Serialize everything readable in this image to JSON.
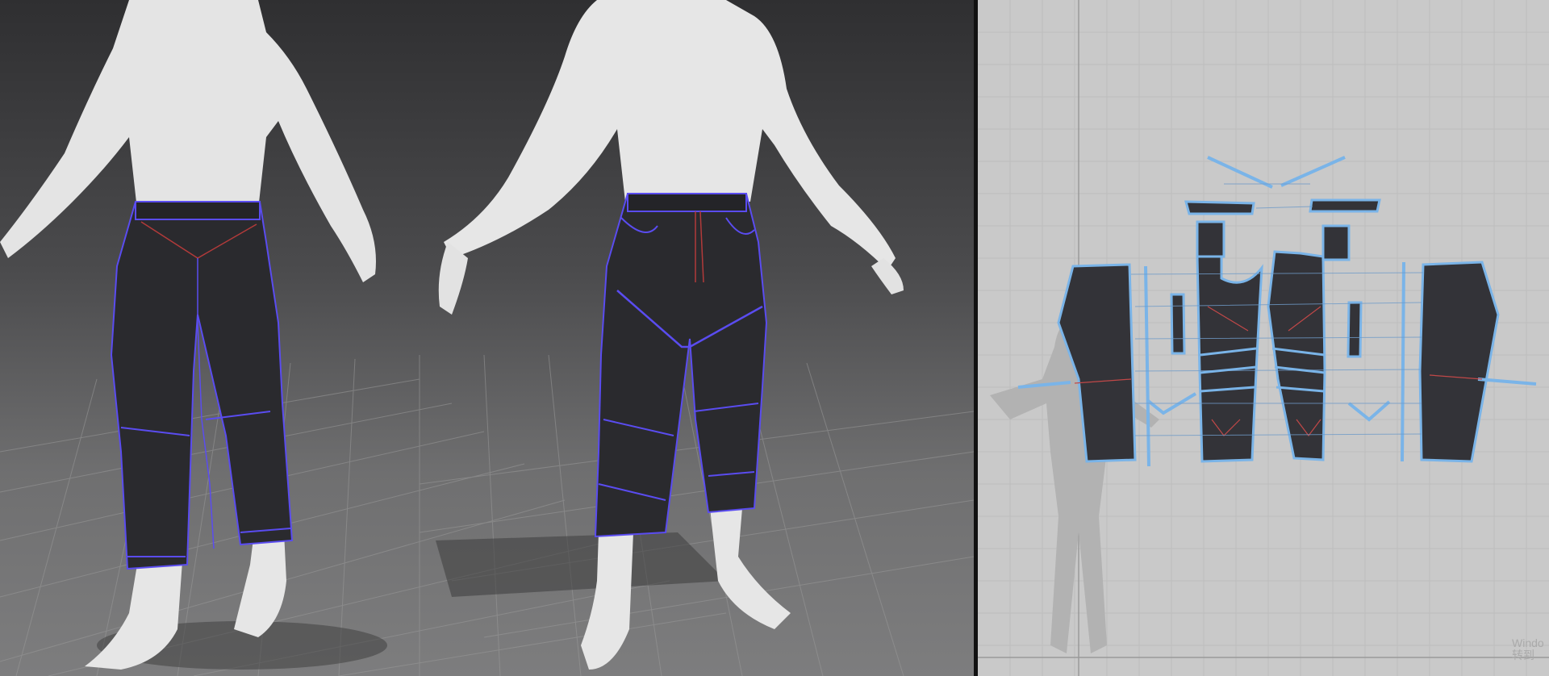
{
  "viewport_3d": {
    "views": [
      "back-view",
      "front-view"
    ],
    "colors": {
      "garment": "#2a2a2e",
      "seam_outline": "#5a4cf0",
      "topstitch": "#b23a3a",
      "avatar": "#e6e6e6",
      "grid_line": "#8e8e8e"
    }
  },
  "viewport_2d": {
    "watermark_line1": "Windo",
    "watermark_line2": "转到"
  },
  "colors": {
    "pattern_fill": "#333338",
    "pattern_outline": "#7ab4e8",
    "background_2d": "#c9c9c9",
    "grid_2d": "#bdbdbd"
  }
}
